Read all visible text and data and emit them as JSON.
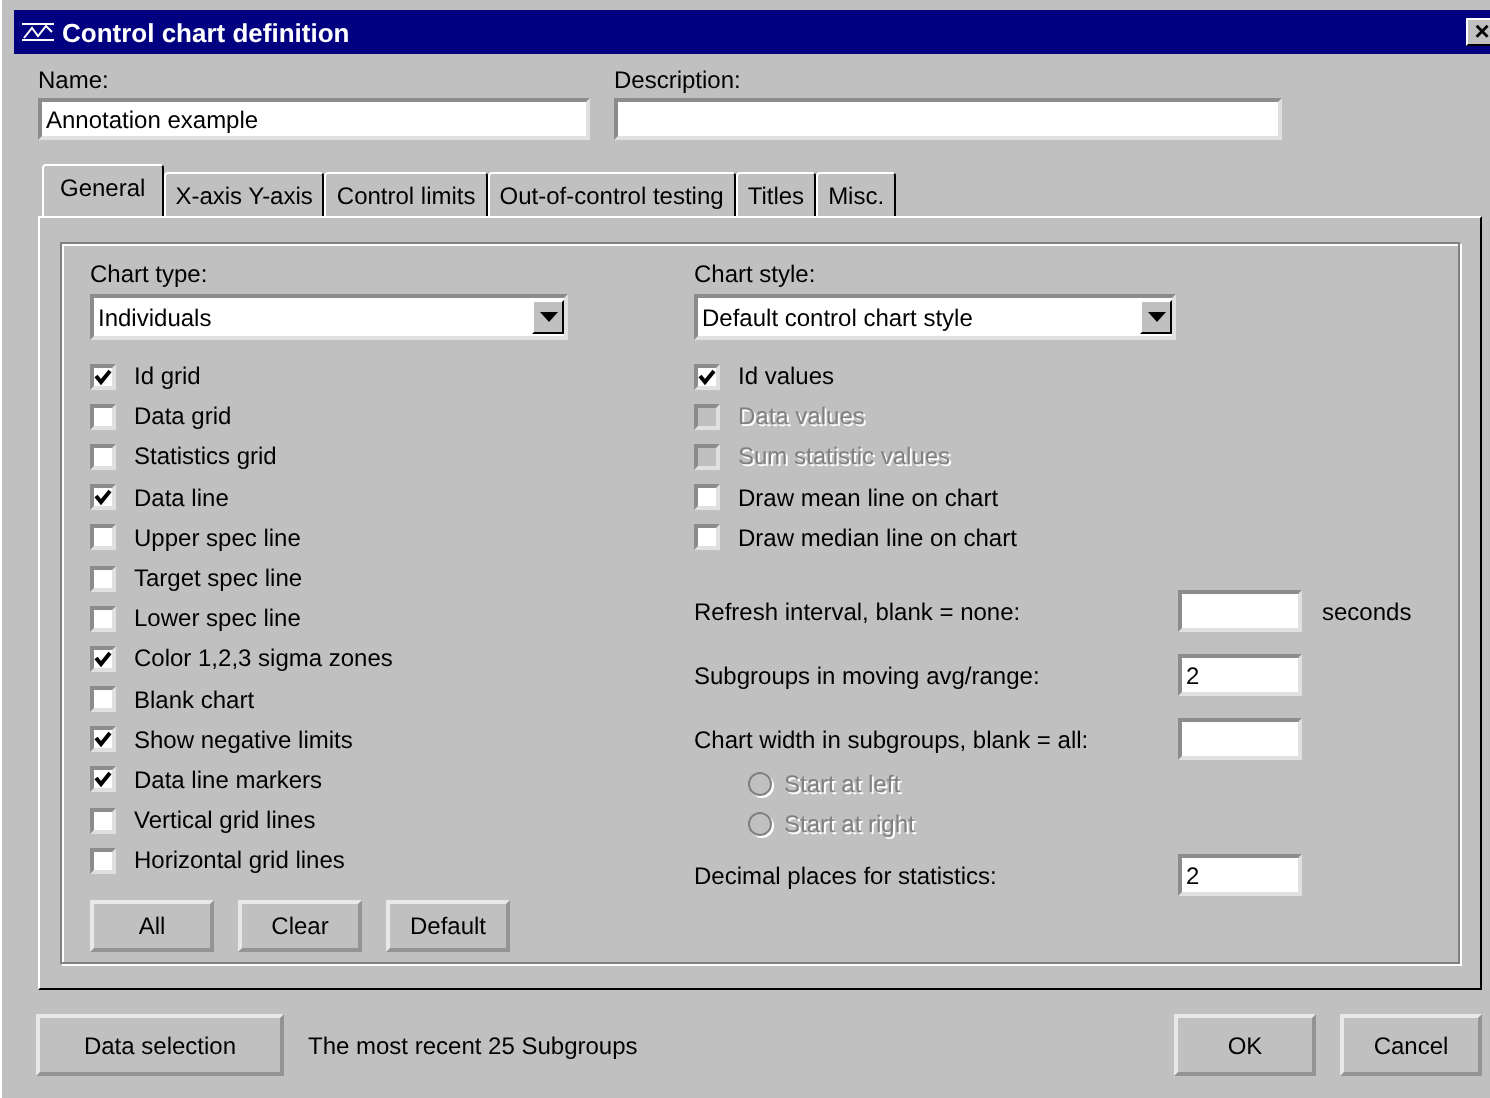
{
  "window": {
    "title": "Control chart definition",
    "close": "×"
  },
  "name": {
    "label": "Name:",
    "value": "Annotation example"
  },
  "description": {
    "label": "Description:"
  },
  "tabs": [
    {
      "label": "General",
      "selected": true
    },
    {
      "label": "X-axis Y-axis",
      "selected": false
    },
    {
      "label": "Control limits",
      "selected": false
    },
    {
      "label": "Out-of-control testing",
      "selected": false
    },
    {
      "label": "Titles",
      "selected": false
    },
    {
      "label": "Misc.",
      "selected": false
    }
  ],
  "chart_type": {
    "label": "Chart type:",
    "value": "Individuals"
  },
  "chart_options": [
    {
      "label": "Id grid",
      "checked": true
    },
    {
      "label": "Data grid",
      "checked": false
    },
    {
      "label": "Statistics grid",
      "checked": false
    },
    {
      "label": "Data line",
      "checked": true
    },
    {
      "label": "Upper spec line",
      "checked": false
    },
    {
      "label": "Target spec line",
      "checked": false
    },
    {
      "label": "Lower spec line",
      "checked": false
    },
    {
      "label": "Color 1,2,3 sigma zones",
      "checked": true
    },
    {
      "label": "Blank chart",
      "checked": false
    },
    {
      "label": "Show negative limits",
      "checked": true
    },
    {
      "label": "Data line markers",
      "checked": true
    },
    {
      "label": "Vertical grid lines",
      "checked": false
    },
    {
      "label": "Horizontal grid lines",
      "checked": false
    }
  ],
  "option_buttons": [
    "All",
    "Clear",
    "Default"
  ],
  "chart_style": {
    "label": "Chart style:",
    "value": "Default control chart style"
  },
  "style_options": [
    {
      "label": "Id values",
      "checked": true,
      "disabled": false
    },
    {
      "label": "Data values",
      "checked": false,
      "disabled": true
    },
    {
      "label": "Sum statistic values",
      "checked": false,
      "disabled": true
    },
    {
      "label": "Draw mean line on chart",
      "checked": false,
      "disabled": false
    },
    {
      "label": "Draw median line on chart",
      "checked": false,
      "disabled": false
    }
  ],
  "refresh": {
    "label": "Refresh interval, blank = none:",
    "unit": "seconds"
  },
  "subgroups_moving": {
    "label": "Subgroups in moving avg/range:",
    "value": "2"
  },
  "chart_width": {
    "label": "Chart width in subgroups, blank = all:"
  },
  "start_options": [
    {
      "label": "Start at left",
      "selected": false,
      "disabled": true
    },
    {
      "label": "Start at right",
      "selected": false,
      "disabled": true
    }
  ],
  "decimal_places": {
    "label": "Decimal places for statistics:",
    "value": "2"
  },
  "data_selection": {
    "button": "Data selection",
    "summary": "The most recent 25 Subgroups"
  },
  "buttons": [
    "OK",
    "Cancel"
  ]
}
